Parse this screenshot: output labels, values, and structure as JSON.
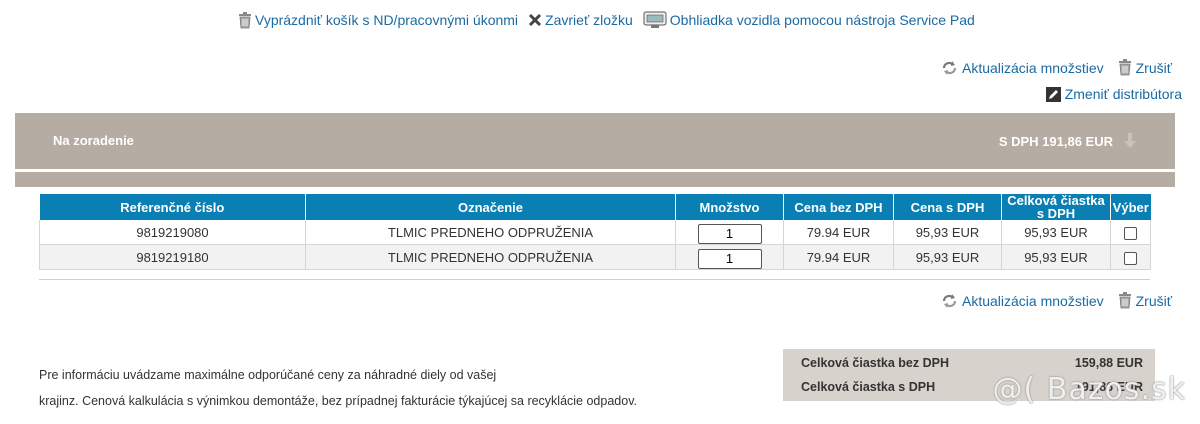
{
  "top_links": {
    "empty_cart": "Vyprázdniť košík s ND/pracovnými úkonmi",
    "close_folder": "Zavrieť zložku",
    "vehicle_inspection": "Obhliadka vozidla pomocou nástroja Service Pad"
  },
  "actions": {
    "update_qty": "Aktualizácia množstiev",
    "cancel": "Zrušiť",
    "change_distributor": "Zmeniť distribútora"
  },
  "banner": {
    "label": "Na zoradenie",
    "total": "S DPH 191,86  EUR"
  },
  "table": {
    "headers": [
      "Referenčné číslo",
      "Označenie",
      "Množstvo",
      "Cena bez DPH",
      "Cena s DPH",
      "Celková čiastka s DPH",
      "Výber"
    ],
    "rows": [
      {
        "ref": "9819219080",
        "name": "TLMIC PREDNEHO ODPRUŽENIA",
        "qty": "1",
        "price_net": "79.94 EUR",
        "price_gross": "95,93 EUR",
        "total": "95,93 EUR",
        "selected": false
      },
      {
        "ref": "9819219180",
        "name": "TLMIC PREDNEHO ODPRUŽENIA",
        "qty": "1",
        "price_net": "79.94 EUR",
        "price_gross": "95,93 EUR",
        "total": "95,93 EUR",
        "selected": false
      }
    ]
  },
  "note": {
    "line1": "Pre informáciu uvádzame maximálne odporúčané ceny za náhradné diely od vašej",
    "line2": "krajinz. Cenová kalkulácia s výnimkou demontáže, bez prípadnej fakturácie týkajúcej sa recyklácie odpadov."
  },
  "totals": {
    "net_label": "Celková čiastka bez DPH",
    "net_value": "159,88  EUR",
    "gross_label": "Celková čiastka s DPH",
    "gross_value": "191,86  EUR"
  },
  "watermark": "@( Bazos.sk",
  "icons": {
    "trash": "trash-icon",
    "close": "close-x-icon",
    "monitor": "monitor-icon",
    "refresh": "refresh-icon",
    "edit": "edit-icon",
    "arrow": "arrow-down-icon"
  }
}
